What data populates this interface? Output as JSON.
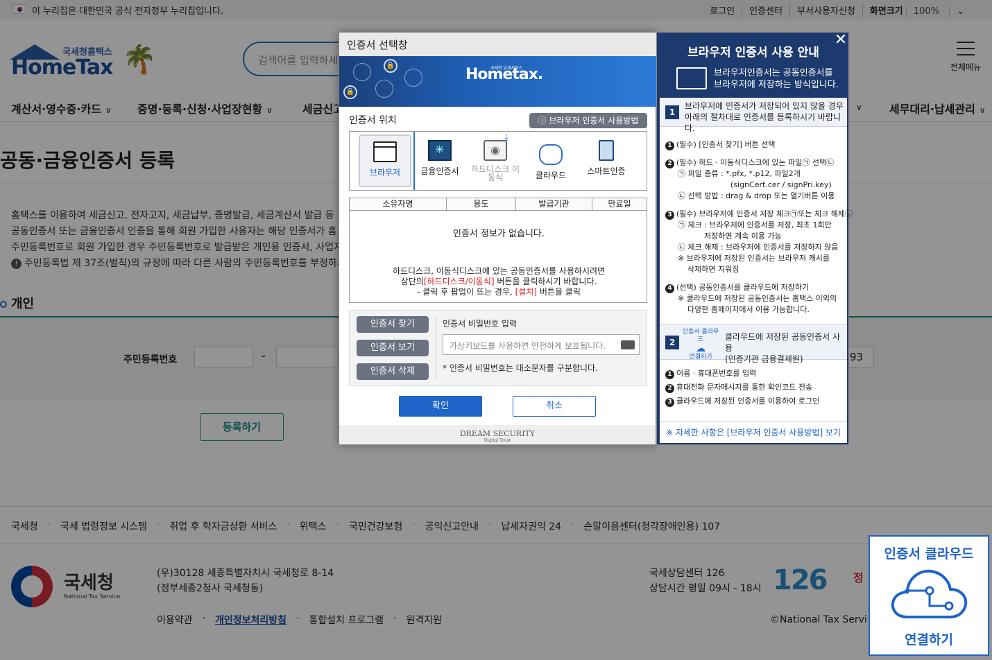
{
  "gov_bar": {
    "text": "이 누리집은 대한민국 공식 전자정부 누리집입니다.",
    "links": [
      "로그인",
      "인증센터",
      "부서사용자신청"
    ],
    "zoom_label": "화면크기",
    "zoom_value": "100%"
  },
  "header": {
    "logo_sub": "국세청홈택스",
    "logo_main": "HomeTax",
    "search_placeholder": "검색어를 입력하세",
    "all_menu": "전체메뉴"
  },
  "gnb": {
    "items": [
      "계산서·영수증·카드",
      "증명·등록·신청·사업장현황",
      "세금신고",
      "세무대리·납세관리"
    ]
  },
  "page": {
    "title": "공동·금융인증서 등록",
    "info_lines": [
      "홈택스를 이용하여 세금신고, 전자고지, 세금납부, 증명발급, 세금계산서 발급 등",
      "공동인증서 또는 금융인증서 인증을 통해 회원 가입한 사용자는 해당 인증서가 홈",
      "주민등록번호로 회원 가입한 경우 주민등록번호로 발급받은 개인용 인증서, 사업자",
      "주민등록법 제 37조(벌칙)의 규정에 따라 다른 사람의 주민등록번호를 부정하게"
    ],
    "section": "개인",
    "rrn_label": "주민등록번호",
    "rrn_dash": "-",
    "rrn_right": "93",
    "register_button": "등록하기"
  },
  "footer": {
    "links": [
      "국세청",
      "국세 법령정보 시스템",
      "취업 후 학자금상환 서비스",
      "위택스",
      "국민건강보험",
      "공익신고안내",
      "납세자권익 24",
      "손말이음센터(청각장애인용) 107"
    ],
    "org_name": "국세청",
    "org_en": "National Tax Service",
    "address_1": "(우)30128 세종특별자치시 국세청로 8-14",
    "address_2": "(정부세종2청사 국세청동)",
    "menu": [
      "이용약관",
      "개인정보처리방침",
      "통합설치 프로그램",
      "원격지원"
    ],
    "center_1": "국세상담센터 126",
    "center_2": "상담시간 평일 09시 - 18시",
    "logo_126": "126",
    "copyright": "©National Tax Servi",
    "gov_mark": "정"
  },
  "modal": {
    "title": "인증서 선택창",
    "banner_logo": "Hometax.",
    "banner_sub": "국세청 납세서비스",
    "location_label": "인증서 위치",
    "how_button": "브라우저 인증서 사용방법",
    "locations": [
      {
        "label": "브라우저",
        "icon": "browser-icon"
      },
      {
        "label": "금융인증서",
        "icon": "financial-cert-icon"
      },
      {
        "label": "하드디스크 이동식",
        "icon": "harddisk-icon"
      },
      {
        "label": "클라우드",
        "icon": "cloud-icon"
      },
      {
        "label": "스마트인증",
        "icon": "smart-cert-icon"
      }
    ],
    "table_headers": [
      "소유자명",
      "용도",
      "발급기관",
      "만료일"
    ],
    "empty_text": "인증서 정보가 없습니다.",
    "help_1": "하드디스크, 이동식디스크에 있는 공동인증서를 사용하시려면",
    "help_2a": "상단의",
    "help_2b": "[하드디스크/이동식]",
    "help_2c": "버튼을 클릭하시기 바랍니다.",
    "help_3a": "- 클릭 후 팝업이 뜨는 경우,",
    "help_3b": "[설치]",
    "help_3c": "버튼을 클릭",
    "find_button": "인증서 찾기",
    "view_button": "인증서 보기",
    "delete_button": "인증서 삭제",
    "pw_label": "인증서 비밀번호 입력",
    "pw_placeholder": "가상키보드를 사용하면 안전하게 보호됩니다.",
    "pw_note": "* 인증서 비밀번호는 대소문자를 구분합니다.",
    "ok_button": "확인",
    "cancel_button": "취소",
    "vendor": "DREAM SECURITY",
    "vendor_sub": "Digital Trust"
  },
  "guide": {
    "title": "브라우저 인증서 사용 안내",
    "intro_1": "브라우저인증서는 공동인증서를",
    "intro_2": "브라우저에 저장하는 방식입니다.",
    "step1_num": "1",
    "step1_1": "브라우저에 인증서가 저장되어 있지 않을 경우",
    "step1_2": "아래의 절차대로 인증서를 등록하시기 바랍니다.",
    "lines": [
      "(필수) [인증서 찾기] 버튼 선택",
      "(필수) 하드 · 이동식디스크에 있는 파일㉠ 선택㉡",
      "㉠ 파일 종류 : *.pfx, *.p12, 파일2개",
      "(signCert.cer / signPri.key)",
      "㉡ 선택 방법 : drag & drop 또는 열기버튼 이용",
      "(필수) 브라우저에 인증서 저장 체크㉠또는 체크 해제㉡",
      "㉠ 체크 : 브라우저에 인증서를 저장, 최초 1회만",
      "저장하면 계속 이용 가능",
      "㉡ 체크 해제 : 브라우저에 인증서를 저장하지 않음",
      "※ 브라우저에 저장된 인증서는 브라우저 캐시를",
      "삭제하면 지워짐",
      "(선택) 공동인증서를 클라우드에 저장하기",
      "※ 클라우드에 저장된 공동인증서는 홈택스 이외의",
      "다양한 홈페이지에서 이용 가능합니다."
    ],
    "step2_num": "2",
    "step2_cloud_1": "인증서 클라우드",
    "step2_cloud_2": "연결하기",
    "step2_1": "클라우드에 저장된 공동인증서 사용",
    "step2_2": "(인증기관 금융결제원)",
    "step2_lines": [
      "이름 · 휴대폰번호를 입력",
      "휴대전화 문자메시지를 통한 확인코드 전송",
      "클라우드에 저장된 인증서를 이용하여 로그인"
    ],
    "link": "※ 자세한 사항은 [브라우저 인증서 사용방법] 보기"
  },
  "cloud_widget": {
    "title": "인증서 클라우드",
    "action": "연결하기"
  },
  "colors": {
    "primary": "#1d63c8",
    "guide_bg": "#1d3a6e",
    "teal": "#1f8a8a",
    "alert_red": "#e21b1b"
  }
}
